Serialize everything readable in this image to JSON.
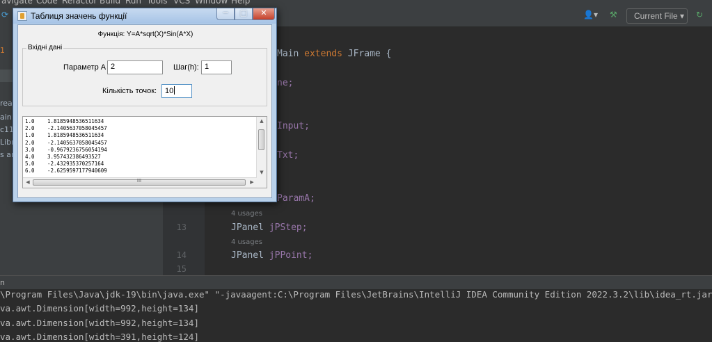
{
  "menu": [
    "avigate",
    "Code",
    "Refactor",
    "Build",
    "Run",
    "Tools",
    "VCS",
    "Window",
    "Help"
  ],
  "toolbar": {
    "config_selector": "Current File ▾"
  },
  "project_tree": [
    "rea",
    "ain",
    "c11",
    "Libr",
    "s ar"
  ],
  "project_tree_number": "1",
  "editor": {
    "lines": [
      {
        "num": "",
        "code_plain": "Main ",
        "code_kw": "extends",
        "code_rest": " JFrame {"
      },
      {
        "num": "",
        "code_field": "ne;"
      },
      {
        "num": "",
        "code_field": "Input;"
      },
      {
        "num": "",
        "code_field": "Txt;"
      },
      {
        "num": "",
        "code_field": "ParamA;"
      },
      {
        "num": "13",
        "code_plain": "JPanel ",
        "code_field": "jPStep;"
      },
      {
        "num": "14",
        "code_plain": "JPanel ",
        "code_field": "jPPoint;"
      },
      {
        "num": "15"
      }
    ],
    "usage_hints": [
      "4 usages",
      "4 usages"
    ]
  },
  "console": {
    "header": "n",
    "lines": [
      "\\Program Files\\Java\\jdk-19\\bin\\java.exe\" \"-javaagent:C:\\Program Files\\JetBrains\\IntelliJ IDEA Community Edition 2022.3.2\\lib\\idea_rt.jar",
      "va.awt.Dimension[width=992,height=134]",
      "va.awt.Dimension[width=992,height=134]",
      "va.awt.Dimension[width=391,height=124]"
    ]
  },
  "dialog": {
    "title": "Таблиця значень функції",
    "formula": "Функція: Y=A*sqrt(X)*Sin(A*X)",
    "group_title": "Вхідні дані",
    "param_a_label": "Параметр A",
    "param_a_value": "2",
    "step_label": "Шаг(h):",
    "step_value": "1",
    "points_label": "Кількість точок:",
    "points_value": "10",
    "table": [
      {
        "x": "1.0",
        "y": "1.8185948536511634"
      },
      {
        "x": "2.0",
        "y": "-2.1405637058045457"
      },
      {
        "x": "1.0",
        "y": "1.8185948536511634"
      },
      {
        "x": "2.0",
        "y": "-2.1405637058045457"
      },
      {
        "x": "3.0",
        "y": "-0.9679236756054194"
      },
      {
        "x": "4.0",
        "y": "3.957432386493527"
      },
      {
        "x": "5.0",
        "y": "-2.432935370257164"
      },
      {
        "x": "6.0",
        "y": "-2.6259597177940609"
      }
    ],
    "hscroll_grip": "III",
    "buttons": {
      "minimize": "─",
      "maximize": "□",
      "close": "✕"
    }
  }
}
